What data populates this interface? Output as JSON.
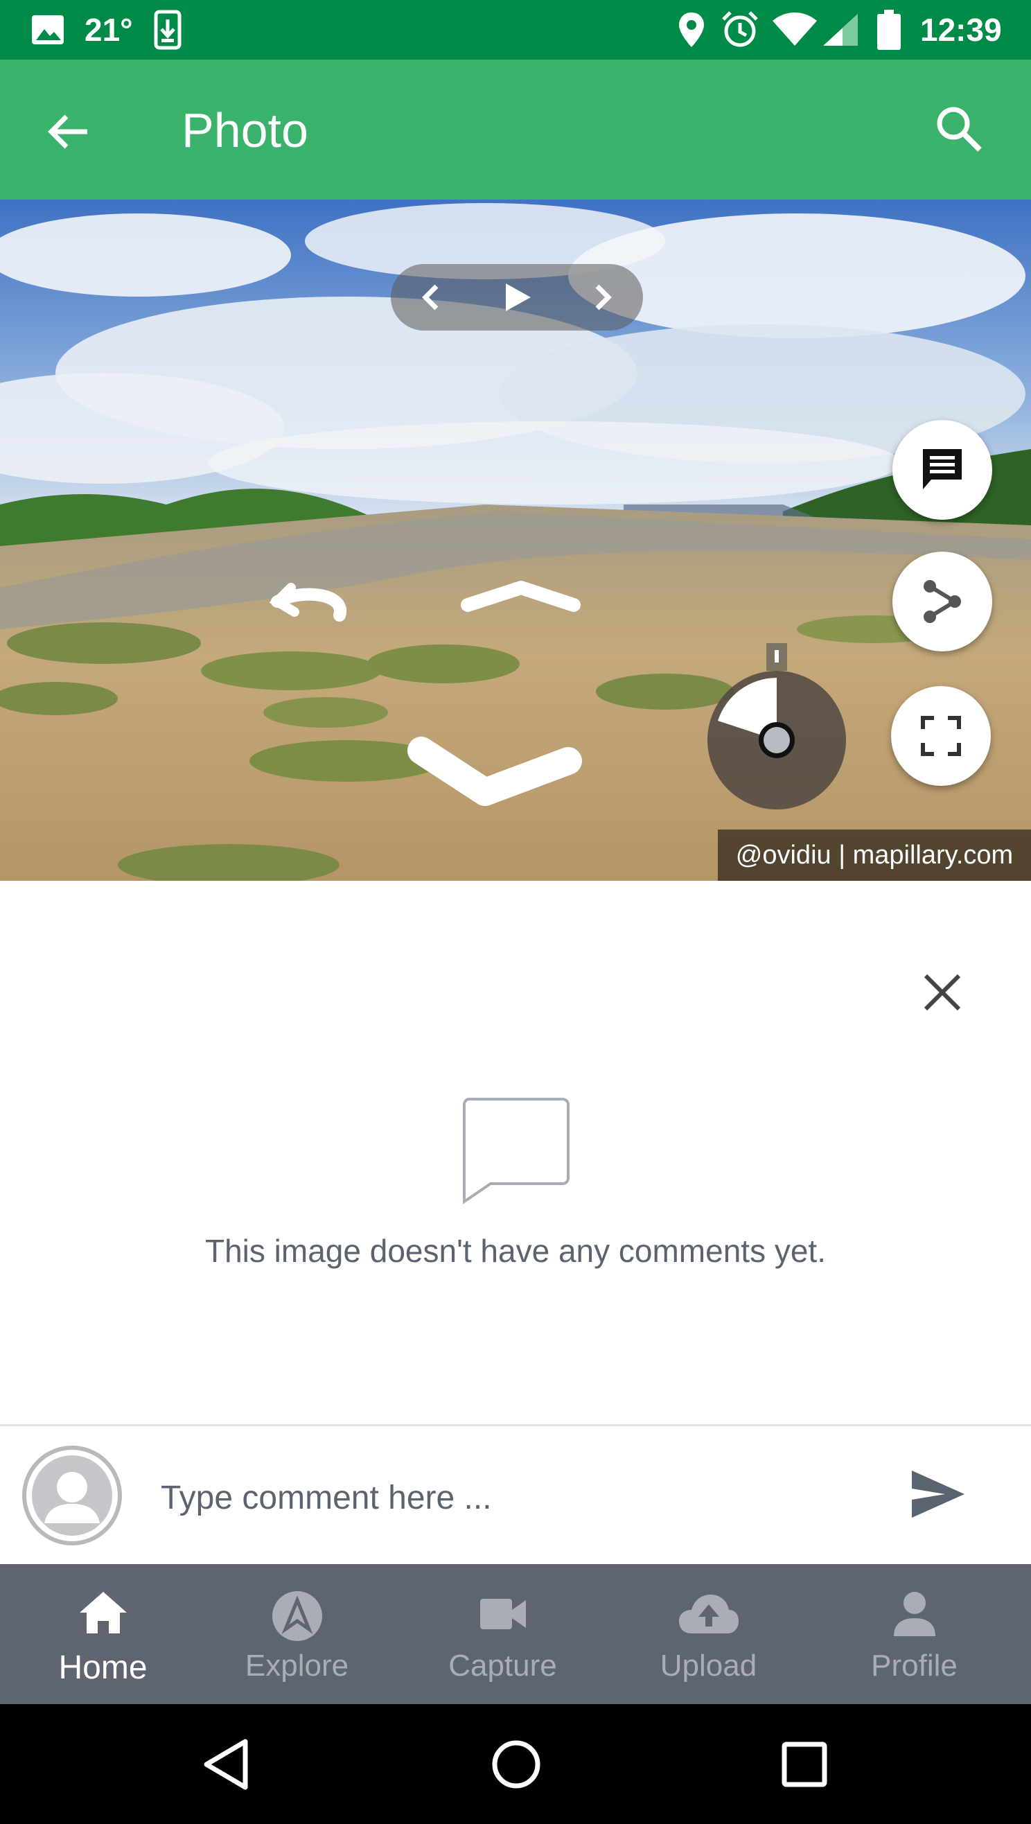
{
  "status_bar": {
    "temperature": "21°",
    "time": "12:39",
    "icons": [
      "image-icon",
      "download-icon",
      "location-icon",
      "alarm-icon",
      "wifi-icon",
      "signal-icon",
      "battery-icon"
    ]
  },
  "app_bar": {
    "title": "Photo",
    "back_icon": "arrow-back-icon",
    "search_icon": "search-icon"
  },
  "viewer": {
    "attribution": "@ovidiu | mapillary.com",
    "playback_controls": [
      "prev-icon",
      "play-icon",
      "next-icon"
    ],
    "side_actions": [
      "comment-icon",
      "share-icon",
      "fullscreen-icon"
    ]
  },
  "comments": {
    "empty_message": "This image doesn't have any comments yet.",
    "input_placeholder": "Type comment here ..."
  },
  "bottom_nav": {
    "items": [
      {
        "label": "Home",
        "icon": "home-icon",
        "active": true
      },
      {
        "label": "Explore",
        "icon": "compass-icon",
        "active": false
      },
      {
        "label": "Capture",
        "icon": "video-camera-icon",
        "active": false
      },
      {
        "label": "Upload",
        "icon": "cloud-upload-icon",
        "active": false
      },
      {
        "label": "Profile",
        "icon": "person-icon",
        "active": false
      }
    ]
  },
  "colors": {
    "status_bar": "#008a47",
    "app_bar": "#3bb26b",
    "bottom_nav": "#5e6470",
    "nav_active": "#ffffff",
    "nav_inactive": "#a9adb6"
  }
}
